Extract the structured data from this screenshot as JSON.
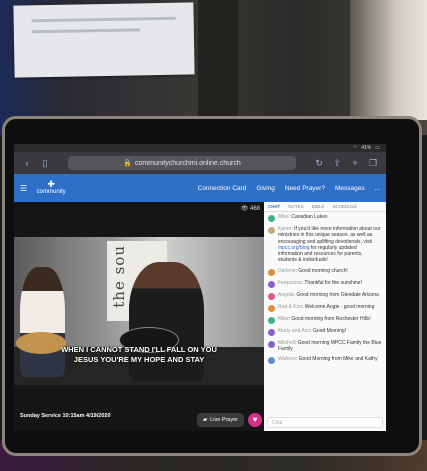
{
  "browser": {
    "url": "communitychurchmi.online.church",
    "battery": "41%"
  },
  "site": {
    "logo_text": "community",
    "nav": [
      "Connection Card",
      "Giving",
      "Need Prayer?",
      "Messages"
    ],
    "more": "..."
  },
  "video": {
    "viewers": "468",
    "sign_text": "the sou",
    "lyric_line1": "WHEN I CANNOT STAND I'LL FALL ON YOU",
    "lyric_line2": "JESUS YOU'RE MY HOPE AND STAY",
    "service_label": "Sunday Service 10:15am 4/19/2020",
    "live_prayer": "Live Prayer"
  },
  "chat": {
    "tabs": [
      "CHAT",
      "NOTES",
      "BIBLE",
      "SCHEDULE"
    ],
    "messages": [
      {
        "name": "Mike",
        "text": "Canadian Lakes",
        "color": "#3bb38a"
      },
      {
        "name": "Karen",
        "text": "If you'd like more information about our ministries in this unique season, as well as encouraging and uplifting devotionals, visit",
        "link": "mpcc.org/blog",
        "text2": "for regularly updated information and resources for parents, students & individuals!",
        "color": "#c9a978"
      },
      {
        "name": "Darlene",
        "text": "Good morning church!",
        "color": "#e58a36"
      },
      {
        "name": "Ferqusons",
        "text": "Thankful for the sunshine!",
        "color": "#8b5fd1"
      },
      {
        "name": "Angela",
        "text": "Good morning from Glendale Arizona",
        "color": "#e0569a"
      },
      {
        "name": "Rod & Kim",
        "text": "Welcome Angie - good morning",
        "color": "#e58a36"
      },
      {
        "name": "Mike",
        "text": "Good morning from Rochester Hills!",
        "color": "#3bb38a"
      },
      {
        "name": "Marty and Ann",
        "text": "Good Morning!",
        "color": "#8b5fd1"
      },
      {
        "name": "Mitchell",
        "text": "Good morning MPCC Family the Blue Family",
        "color": "#8b5fd1"
      },
      {
        "name": "Walkers",
        "text": "Good Morning from Mike and Kathy",
        "color": "#5a8fd6"
      }
    ],
    "input_placeholder": "Chat"
  }
}
